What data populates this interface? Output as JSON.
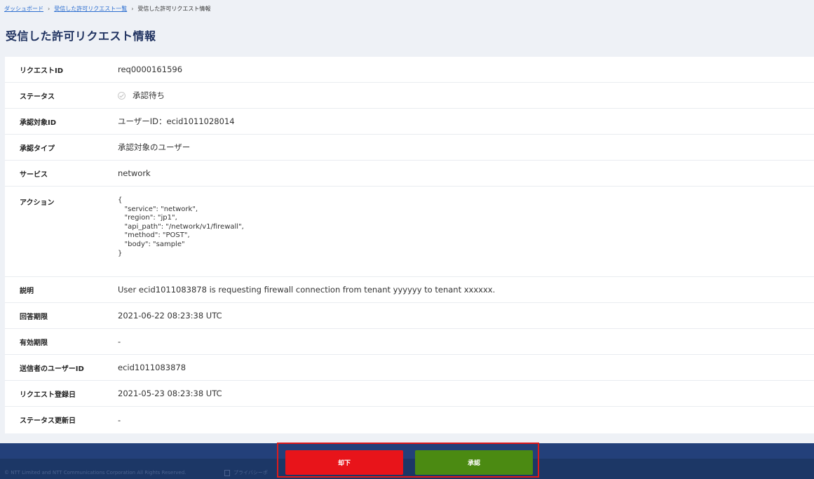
{
  "breadcrumb": {
    "dashboard": "ダッシュボード",
    "list": "受信した許可リクエスト一覧",
    "current": "受信した許可リクエスト情報",
    "separator": "›"
  },
  "page": {
    "title": "受信した許可リクエスト情報"
  },
  "details": {
    "request_id": {
      "label": "リクエストID",
      "value": "req0000161596"
    },
    "status": {
      "label": "ステータス",
      "value": "承認待ち"
    },
    "target_id": {
      "label": "承認対象ID",
      "value": "ユーザーID：ecid1011028014"
    },
    "approval_type": {
      "label": "承認タイプ",
      "value": "承認対象のユーザー"
    },
    "service": {
      "label": "サービス",
      "value": "network"
    },
    "action": {
      "label": "アクション",
      "value": "{\n   \"service\": \"network\",\n   \"region\": \"jp1\",\n   \"api_path\": \"/network/v1/firewall\",\n   \"method\": \"POST\",\n   \"body\": \"sample\"\n}"
    },
    "description": {
      "label": "説明",
      "value": "User ecid1011083878 is requesting firewall connection from tenant yyyyyy to tenant xxxxxx."
    },
    "response_deadline": {
      "label": "回答期限",
      "value": "2021-06-22 08:23:38 UTC"
    },
    "expiration": {
      "label": "有効期限",
      "value": "-"
    },
    "sender_user_id": {
      "label": "送信者のユーザーID",
      "value": "ecid1011083878"
    },
    "registered_date": {
      "label": "リクエスト登録日",
      "value": "2021-05-23 08:23:38 UTC"
    },
    "status_updated": {
      "label": "ステータス更新日",
      "value": "-"
    }
  },
  "buttons": {
    "reject": "却下",
    "approve": "承認"
  },
  "footer": {
    "copyright": "© NTT Limited and NTT Communications Corporation All Rights Reserved.",
    "privacy": "プライバシーポ"
  },
  "colors": {
    "title": "#1f3260",
    "link": "#2d6fd0",
    "reject": "#e8141a",
    "approve": "#4b8a12",
    "footer": "#23407a",
    "highlight": "#e01b1b"
  }
}
